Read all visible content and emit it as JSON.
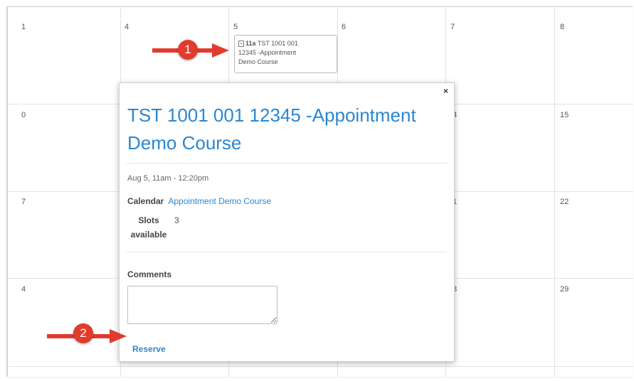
{
  "calendar": {
    "rows": [
      [
        "1",
        "4",
        "5",
        "6",
        "7",
        "8"
      ],
      [
        "0",
        "",
        "",
        "",
        "4",
        "15"
      ],
      [
        "7",
        "",
        "",
        "",
        "1",
        "22"
      ],
      [
        "4",
        "",
        "",
        "",
        "8",
        "29"
      ]
    ]
  },
  "event_chip": {
    "time": "11a",
    "text_line1": "TST 1001 001",
    "text_line2": "12345 -Appointment",
    "text_line3": "Demo Course"
  },
  "popup": {
    "close_glyph": "×",
    "title": "TST 1001 001 12345 -Appointment Demo Course",
    "date": "Aug 5, 11am - 12:20pm",
    "calendar_label": "Calendar",
    "calendar_value": "Appointment Demo Course",
    "slots_label": "Slots available",
    "slots_value": "3",
    "comments_label": "Comments",
    "comments_value": "",
    "reserve_label": "Reserve"
  },
  "callouts": {
    "one": "1",
    "two": "2"
  },
  "colors": {
    "link": "#2b87d1",
    "callout": "#e23b2e",
    "grid": "#e2e2e2"
  },
  "icons": {
    "event": "calendar-icon",
    "close": "close-icon"
  }
}
